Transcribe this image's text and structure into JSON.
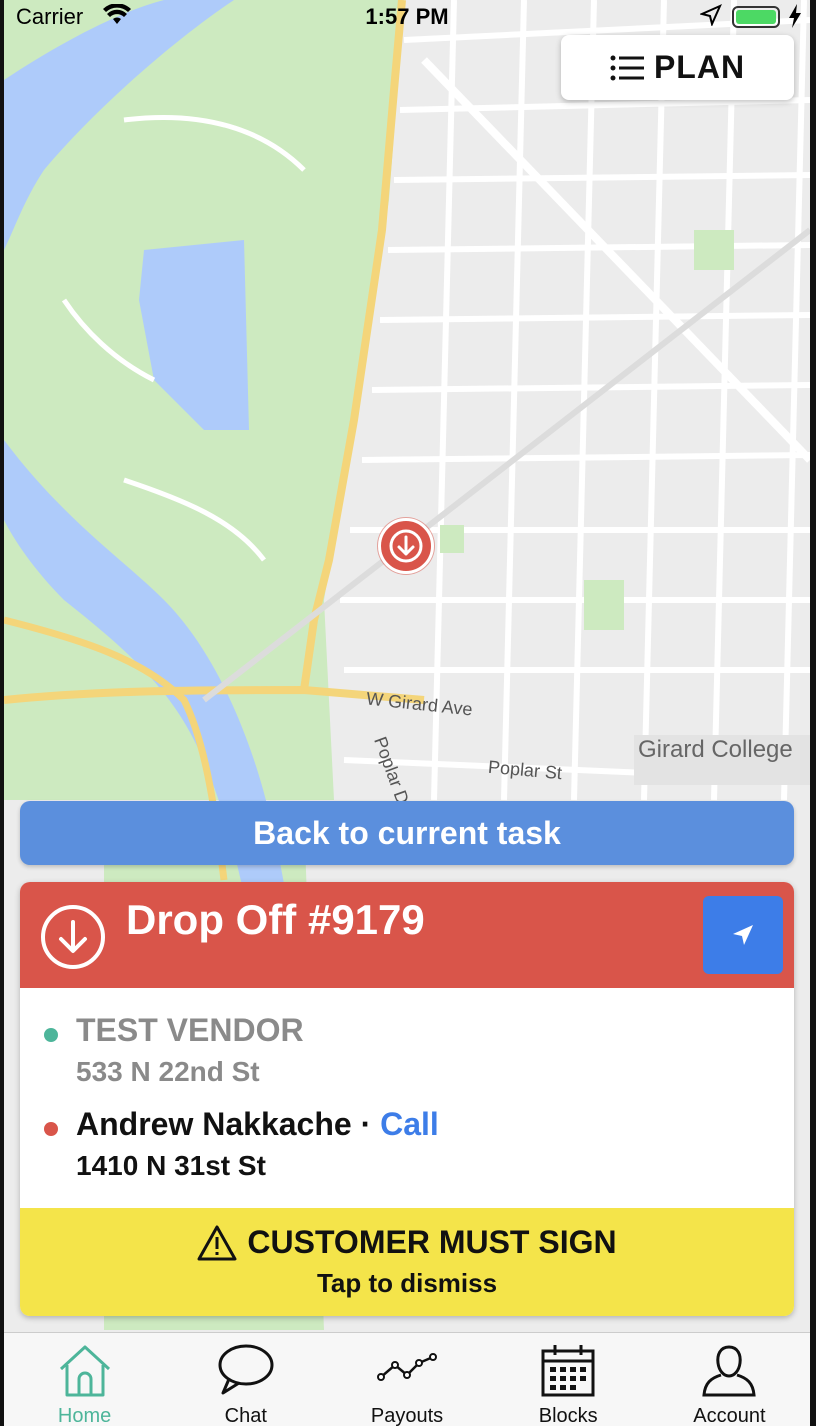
{
  "status_bar": {
    "carrier": "Carrier",
    "time": "1:57 PM",
    "battery_level": 1.0
  },
  "map": {
    "labels": {
      "girard_ave": "W Girard Ave",
      "poplar_dr": "Poplar D",
      "poplar_st": "Poplar St",
      "girard_college": "Girard College"
    },
    "pin_icon": "dropoff-arrow-icon",
    "pin_color": "#d9554a"
  },
  "plan_button": {
    "label": "PLAN",
    "icon": "list-icon"
  },
  "back_button": {
    "label": "Back to current task",
    "color": "#5b8fdd"
  },
  "task": {
    "title": "Drop Off #9179",
    "header_color": "#d9554a",
    "nav_button_color": "#3d7de8",
    "pickup": {
      "name": "TEST VENDOR",
      "address": "533 N 22nd St"
    },
    "dropoff": {
      "name": "Andrew Nakkache",
      "separator": "·",
      "call_label": "Call",
      "address": "1410 N 31st St"
    },
    "sign_banner": {
      "title": "CUSTOMER MUST SIGN",
      "subtitle": "Tap to dismiss",
      "color": "#f4e44a"
    }
  },
  "tabs": [
    {
      "label": "Home",
      "icon": "home-icon",
      "active": true
    },
    {
      "label": "Chat",
      "icon": "chat-icon",
      "active": false
    },
    {
      "label": "Payouts",
      "icon": "payouts-icon",
      "active": false
    },
    {
      "label": "Blocks",
      "icon": "calendar-icon",
      "active": false
    },
    {
      "label": "Account",
      "icon": "account-icon",
      "active": false
    }
  ],
  "accent_color": "#4db59a"
}
